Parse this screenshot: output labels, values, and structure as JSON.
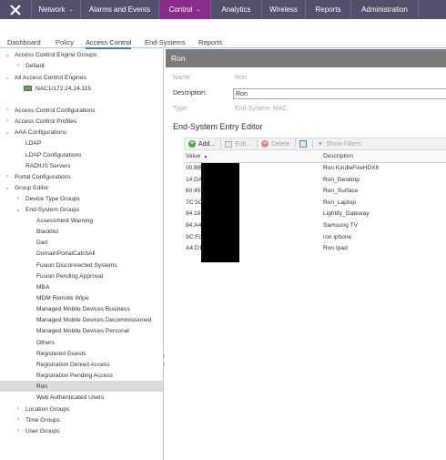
{
  "topnav": {
    "logo_icon": "extreme-logo-icon",
    "items": [
      {
        "label": "Network",
        "caret": "⌄"
      },
      {
        "label": "Alarms and Events",
        "caret": ""
      },
      {
        "label": "Control",
        "caret": "⌄"
      },
      {
        "label": "Analytics",
        "caret": ""
      },
      {
        "label": "Wireless",
        "caret": ""
      },
      {
        "label": "Reports",
        "caret": ""
      },
      {
        "label": "Administration",
        "caret": ""
      }
    ],
    "active_color": "#8c2d8e",
    "bar_color": "#52506a"
  },
  "subtabs": [
    "Dashboard",
    "Policy",
    "Access Control",
    "End-Systems",
    "Reports"
  ],
  "tree": {
    "nodes": [
      {
        "label": "Access Control Engine Groups",
        "toggle": "⌄"
      },
      {
        "label": "Default",
        "toggle": "›"
      },
      {
        "label": "All Access Control Engines",
        "toggle": "⌄"
      },
      {
        "label": "NAC1/172.24.24.115",
        "toggle": ""
      },
      {
        "label": "Access Control Configurations",
        "toggle": "›"
      },
      {
        "label": "Access Control Profiles",
        "toggle": "›"
      },
      {
        "label": "AAA Configurations",
        "toggle": "⌄"
      },
      {
        "label": "LDAP",
        "toggle": ""
      },
      {
        "label": "LDAP Configurations",
        "toggle": ""
      },
      {
        "label": "RADIUS Servers",
        "toggle": ""
      },
      {
        "label": "Portal Configurations",
        "toggle": "›"
      },
      {
        "label": "Group Editor",
        "toggle": "⌄"
      },
      {
        "label": "Device Type Groups",
        "toggle": "›"
      },
      {
        "label": "End-System Groups",
        "toggle": "⌄"
      },
      {
        "label": "Assessment Warning",
        "toggle": ""
      },
      {
        "label": "Blacklist",
        "toggle": ""
      },
      {
        "label": "Dad",
        "toggle": ""
      },
      {
        "label": "DomainPortalCatchAll",
        "toggle": ""
      },
      {
        "label": "Fusion Disconnected Systems",
        "toggle": ""
      },
      {
        "label": "Fusion Pending Approval",
        "toggle": ""
      },
      {
        "label": "MBA",
        "toggle": ""
      },
      {
        "label": "MDM Remote Wipe",
        "toggle": ""
      },
      {
        "label": "Managed Mobile Devices Business",
        "toggle": ""
      },
      {
        "label": "Managed Mobile Devices Decommissioned",
        "toggle": ""
      },
      {
        "label": "Managed Mobile Devices Personal",
        "toggle": ""
      },
      {
        "label": "Others",
        "toggle": ""
      },
      {
        "label": "Registered Guests",
        "toggle": ""
      },
      {
        "label": "Registration Denied Access",
        "toggle": ""
      },
      {
        "label": "Registration Pending Access",
        "toggle": ""
      },
      {
        "label": "Ron",
        "toggle": ""
      },
      {
        "label": "Web Authenticated Users",
        "toggle": ""
      },
      {
        "label": "Location Groups",
        "toggle": "›"
      },
      {
        "label": "Time Groups",
        "toggle": "›"
      },
      {
        "label": "User Groups",
        "toggle": "›"
      }
    ]
  },
  "panel": {
    "title": "Ron",
    "name_label": "Name:",
    "name_value": "Ron",
    "description_label": "Description:",
    "description_value": "Ron",
    "type_label": "Type:",
    "type_value": "End-System: MAC",
    "section_title": "End-System Entry Editor",
    "toolbar": {
      "add": "Add...",
      "edit": "Edit...",
      "delete": "Delete",
      "show_filters": "Show Filters"
    },
    "columns": {
      "value": "Value",
      "description": "Description"
    },
    "rows": [
      {
        "value": "00:BB:",
        "description": "Ron KindleFireHDX8"
      },
      {
        "value": "14:DA",
        "description": "Ron_Desktop"
      },
      {
        "value": "60:45:",
        "description": "Ron_Surface"
      },
      {
        "value": "7C:5C",
        "description": "Ron_Laptop"
      },
      {
        "value": "84:18:",
        "description": "Lightify_Gateway"
      },
      {
        "value": "84:A4:",
        "description": "Samsung TV"
      },
      {
        "value": "9C:FC",
        "description": "ron iphone"
      },
      {
        "value": "A4:D1:",
        "description": "Ron Ipad"
      }
    ]
  }
}
